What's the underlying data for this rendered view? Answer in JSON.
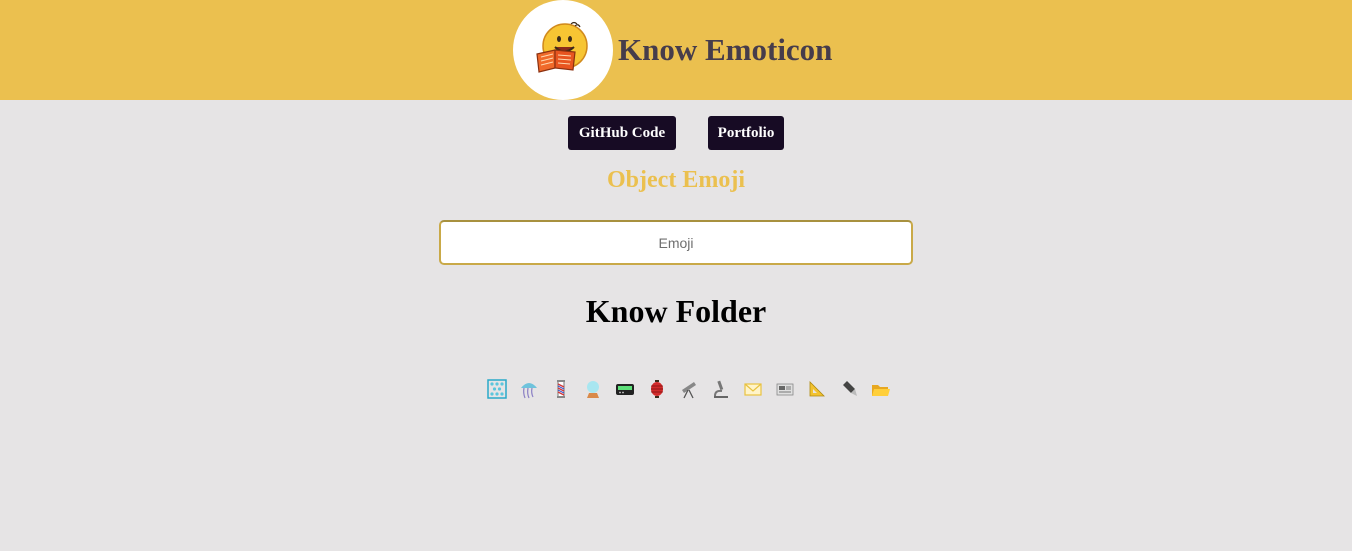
{
  "header": {
    "title": "Know Emoticon",
    "logo_icon": "smiley-reading-book-icon",
    "background_color": "#ebc04f",
    "title_color": "#463c4b"
  },
  "nav": {
    "github_label": "GitHub Code",
    "portfolio_label": "Portfolio"
  },
  "section": {
    "title": "Object Emoji",
    "title_color": "#ebc04f"
  },
  "search": {
    "placeholder": "Emoji",
    "value": ""
  },
  "result": {
    "title": "Know Folder"
  },
  "emojis": [
    {
      "name": "abacus-icon"
    },
    {
      "name": "jellyfish-icon"
    },
    {
      "name": "barber-pole-icon"
    },
    {
      "name": "crystal-ball-icon"
    },
    {
      "name": "pager-icon"
    },
    {
      "name": "red-paper-lantern-icon"
    },
    {
      "name": "telescope-icon"
    },
    {
      "name": "microscope-icon"
    },
    {
      "name": "envelope-icon"
    },
    {
      "name": "newspaper-icon"
    },
    {
      "name": "triangular-ruler-icon"
    },
    {
      "name": "pen-icon"
    },
    {
      "name": "open-file-folder-icon"
    }
  ]
}
